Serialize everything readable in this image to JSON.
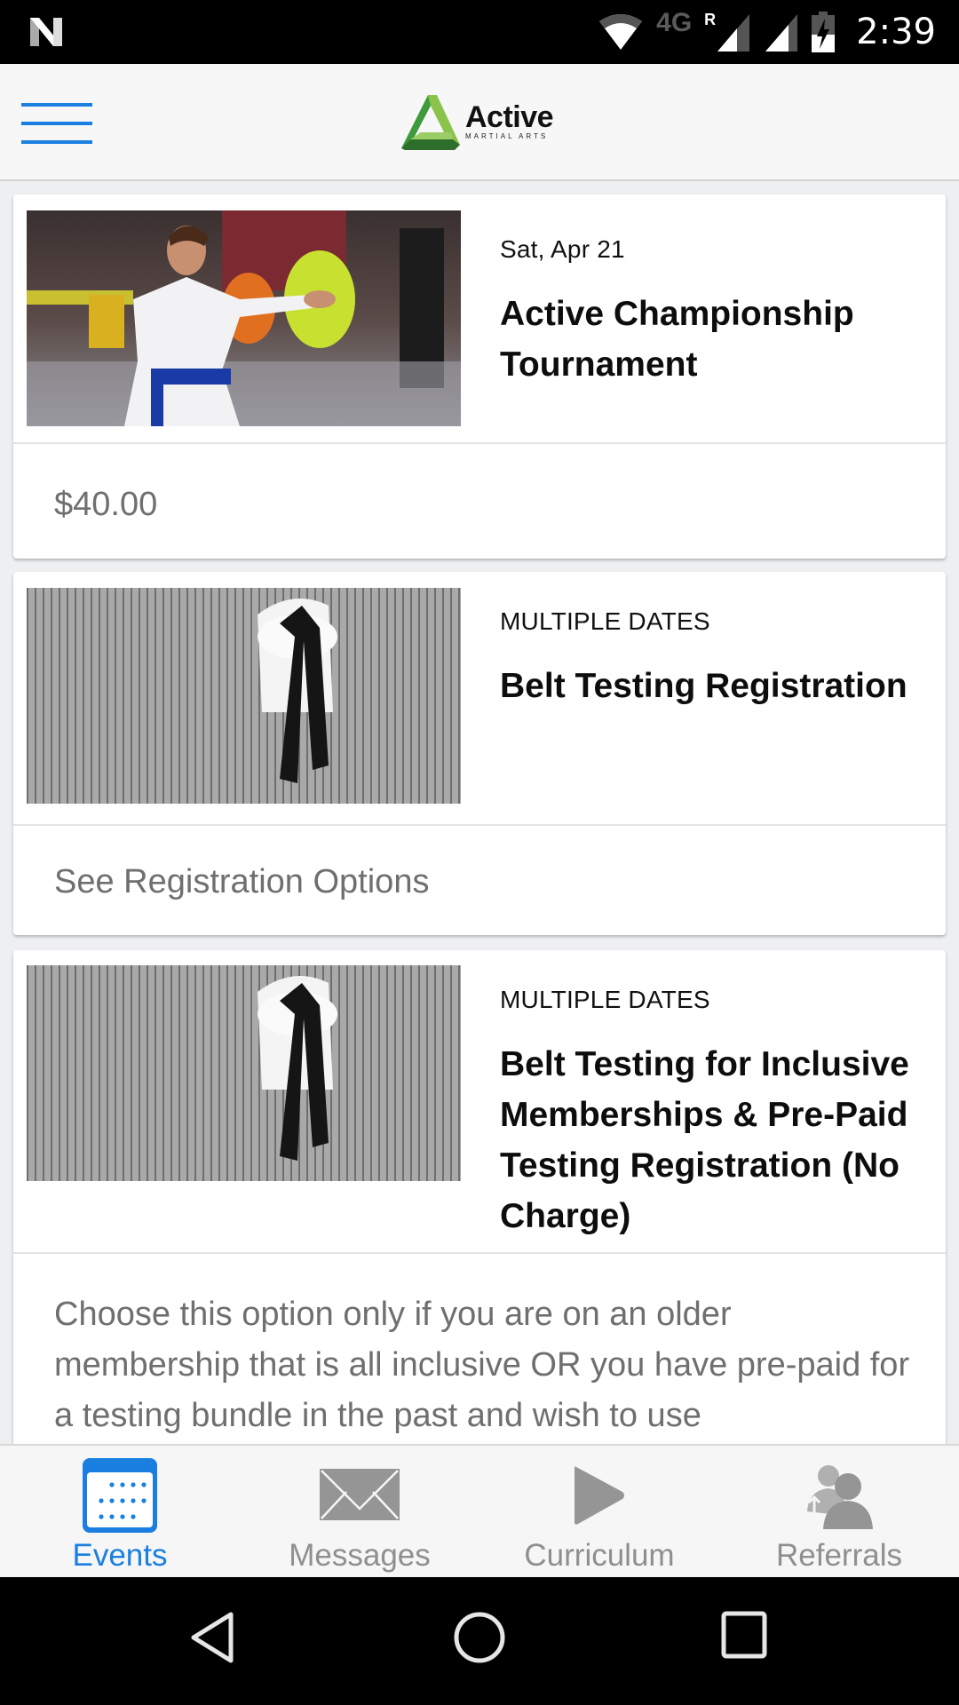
{
  "status_bar": {
    "time": "2:39",
    "network": "4G",
    "roaming": "R",
    "icons": [
      "n-logo-icon",
      "wifi-icon",
      "signal-roaming-icon",
      "signal-icon",
      "battery-charging-icon"
    ]
  },
  "app_bar": {
    "menu_icon": "hamburger-menu-icon",
    "logo_name": "Active",
    "logo_subtitle": "MARTIAL ARTS"
  },
  "events": [
    {
      "date": "Sat, Apr 21",
      "title": "Active Championship Tournament",
      "footer": "$40.00",
      "image": "karate-student-photo"
    },
    {
      "date": "MULTIPLE DATES",
      "title": "Belt Testing Registration",
      "footer": "See Registration Options",
      "image": "black-belt-gi-photo"
    },
    {
      "date": "MULTIPLE DATES",
      "title": "Belt Testing for Inclusive Memberships & Pre-Paid Testing Registration (No Charge)",
      "footer": "Choose this option only if you are on an older membership that is all inclusive OR you have pre-paid for a testing bundle in the past and wish to use",
      "image": "black-belt-gi-photo"
    }
  ],
  "bottom_nav": {
    "accent": "#1a7fe0",
    "inactive": "#8f8f8f",
    "items": [
      {
        "label": "Events",
        "icon": "calendar-icon",
        "active": true
      },
      {
        "label": "Messages",
        "icon": "envelope-icon",
        "active": false
      },
      {
        "label": "Curriculum",
        "icon": "play-icon",
        "active": false
      },
      {
        "label": "Referrals",
        "icon": "users-icon",
        "active": false
      }
    ]
  },
  "system_nav": {
    "buttons": [
      "back-icon",
      "home-icon",
      "recents-icon"
    ]
  }
}
